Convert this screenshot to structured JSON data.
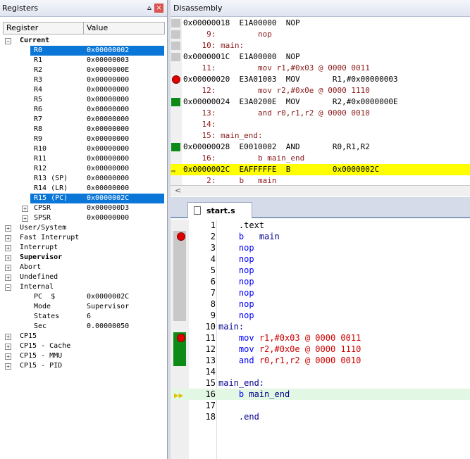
{
  "registers_panel": {
    "title": "Registers",
    "pin_icon": "⩟",
    "close_icon": "×",
    "col_register": "Register",
    "col_value": "Value",
    "rows": [
      {
        "name": "Current",
        "value": "",
        "indent": 0,
        "expand": "-",
        "bold": true
      },
      {
        "name": "R0",
        "value": "0x00000002",
        "indent": 2,
        "selected": true
      },
      {
        "name": "R1",
        "value": "0x00000003",
        "indent": 2
      },
      {
        "name": "R2",
        "value": "0x0000000E",
        "indent": 2
      },
      {
        "name": "R3",
        "value": "0x00000000",
        "indent": 2
      },
      {
        "name": "R4",
        "value": "0x00000000",
        "indent": 2
      },
      {
        "name": "R5",
        "value": "0x00000000",
        "indent": 2
      },
      {
        "name": "R6",
        "value": "0x00000000",
        "indent": 2
      },
      {
        "name": "R7",
        "value": "0x00000000",
        "indent": 2
      },
      {
        "name": "R8",
        "value": "0x00000000",
        "indent": 2
      },
      {
        "name": "R9",
        "value": "0x00000000",
        "indent": 2
      },
      {
        "name": "R10",
        "value": "0x00000000",
        "indent": 2
      },
      {
        "name": "R11",
        "value": "0x00000000",
        "indent": 2
      },
      {
        "name": "R12",
        "value": "0x00000000",
        "indent": 2
      },
      {
        "name": "R13 (SP)",
        "value": "0x00000000",
        "indent": 2
      },
      {
        "name": "R14 (LR)",
        "value": "0x00000000",
        "indent": 2
      },
      {
        "name": "R15 (PC)",
        "value": "0x0000002C",
        "indent": 2,
        "selected": true
      },
      {
        "name": "CPSR",
        "value": "0x000000D3",
        "indent": 2,
        "expand": "+"
      },
      {
        "name": "SPSR",
        "value": "0x00000000",
        "indent": 2,
        "expand": "+"
      },
      {
        "name": "User/System",
        "value": "",
        "indent": 0,
        "expand": "+"
      },
      {
        "name": "Fast Interrupt",
        "value": "",
        "indent": 0,
        "expand": "+"
      },
      {
        "name": "Interrupt",
        "value": "",
        "indent": 0,
        "expand": "+"
      },
      {
        "name": "Supervisor",
        "value": "",
        "indent": 0,
        "expand": "+",
        "bold": true
      },
      {
        "name": "Abort",
        "value": "",
        "indent": 0,
        "expand": "+"
      },
      {
        "name": "Undefined",
        "value": "",
        "indent": 0,
        "expand": "+"
      },
      {
        "name": "Internal",
        "value": "",
        "indent": 0,
        "expand": "-"
      },
      {
        "name": "PC  $",
        "value": "0x0000002C",
        "indent": 2
      },
      {
        "name": "Mode",
        "value": "Supervisor",
        "indent": 2
      },
      {
        "name": "States",
        "value": "6",
        "indent": 2
      },
      {
        "name": "Sec",
        "value": "0.00000050",
        "indent": 2
      },
      {
        "name": "CP15",
        "value": "",
        "indent": 0,
        "expand": "+"
      },
      {
        "name": "CP15 - Cache",
        "value": "",
        "indent": 0,
        "expand": "+"
      },
      {
        "name": "CP15 - MMU",
        "value": "",
        "indent": 0,
        "expand": "+"
      },
      {
        "name": "CP15 - PID",
        "value": "",
        "indent": 0,
        "expand": "+"
      }
    ]
  },
  "disassembly": {
    "title": "Disassembly",
    "scroll_left": "<",
    "rows": [
      {
        "text": "0x00000018  E1A00000  NOP",
        "kind": "asm",
        "mark": "gray"
      },
      {
        "text": "     9:         nop",
        "kind": "src",
        "mark": "gray"
      },
      {
        "text": "    10: main:",
        "kind": "src",
        "mark": "gray"
      },
      {
        "text": "0x0000001C  E1A00000  NOP",
        "kind": "asm",
        "mark": "gray"
      },
      {
        "text": "    11:         mov r1,#0x03 @ 0000 0011",
        "kind": "src",
        "mark": "none"
      },
      {
        "text": "0x00000020  E3A01003  MOV       R1,#0x00000003",
        "kind": "asm",
        "mark": "bp"
      },
      {
        "text": "    12:         mov r2,#0x0e @ 0000 1110",
        "kind": "src",
        "mark": "none"
      },
      {
        "text": "0x00000024  E3A0200E  MOV       R2,#0x0000000E",
        "kind": "asm",
        "mark": "green"
      },
      {
        "text": "    13:         and r0,r1,r2 @ 0000 0010",
        "kind": "src",
        "mark": "none"
      },
      {
        "text": "    14:",
        "kind": "src",
        "mark": "none"
      },
      {
        "text": "    15: main_end:",
        "kind": "src",
        "mark": "none"
      },
      {
        "text": "0x00000028  E0010002  AND       R0,R1,R2",
        "kind": "asm",
        "mark": "green"
      },
      {
        "text": "    16:         b main_end",
        "kind": "src",
        "mark": "none"
      },
      {
        "text": "0x0000002C  EAFFFFFE  B         0x0000002C",
        "kind": "asm",
        "mark": "arrow",
        "current": true
      },
      {
        "text": "     2:     b   main",
        "kind": "src",
        "mark": "none"
      }
    ]
  },
  "editor": {
    "tab_label": "start.s",
    "lines": [
      {
        "n": "1",
        "code": [
          [
            "    .text",
            ""
          ]
        ],
        "mark": "none"
      },
      {
        "n": "2",
        "code": [
          [
            "    ",
            ""
          ],
          [
            "b",
            "kw"
          ],
          [
            "   main",
            "lbl"
          ]
        ],
        "mark": "bp-gray"
      },
      {
        "n": "3",
        "code": [
          [
            "    ",
            ""
          ],
          [
            "nop",
            "kw"
          ]
        ],
        "mark": "gray"
      },
      {
        "n": "4",
        "code": [
          [
            "    ",
            ""
          ],
          [
            "nop",
            "kw"
          ]
        ],
        "mark": "gray"
      },
      {
        "n": "5",
        "code": [
          [
            "    ",
            ""
          ],
          [
            "nop",
            "kw"
          ]
        ],
        "mark": "gray"
      },
      {
        "n": "6",
        "code": [
          [
            "    ",
            ""
          ],
          [
            "nop",
            "kw"
          ]
        ],
        "mark": "gray"
      },
      {
        "n": "7",
        "code": [
          [
            "    ",
            ""
          ],
          [
            "nop",
            "kw"
          ]
        ],
        "mark": "gray"
      },
      {
        "n": "8",
        "code": [
          [
            "    ",
            ""
          ],
          [
            "nop",
            "kw"
          ]
        ],
        "mark": "gray"
      },
      {
        "n": "9",
        "code": [
          [
            "    ",
            ""
          ],
          [
            "nop",
            "kw"
          ]
        ],
        "mark": "gray"
      },
      {
        "n": "10",
        "code": [
          [
            "main:",
            "lbl"
          ]
        ],
        "mark": "none"
      },
      {
        "n": "11",
        "code": [
          [
            "    ",
            ""
          ],
          [
            "mov",
            "kw"
          ],
          [
            " r1,",
            "num"
          ],
          [
            "#0x03",
            "num"
          ],
          [
            " @ 0000 0011",
            "num"
          ]
        ],
        "mark": "bp-green"
      },
      {
        "n": "12",
        "code": [
          [
            "    ",
            ""
          ],
          [
            "mov",
            "kw"
          ],
          [
            " r2,",
            "num"
          ],
          [
            "#0x0e",
            "num"
          ],
          [
            " @ 0000 1110",
            "num"
          ]
        ],
        "mark": "green"
      },
      {
        "n": "13",
        "code": [
          [
            "    ",
            ""
          ],
          [
            "and",
            "kw"
          ],
          [
            " r0,r1,r2",
            "num"
          ],
          [
            " @ 0000 0010",
            "num"
          ]
        ],
        "mark": "green"
      },
      {
        "n": "14",
        "code": [],
        "mark": "none"
      },
      {
        "n": "15",
        "code": [
          [
            "main_end:",
            "lbl"
          ]
        ],
        "mark": "none"
      },
      {
        "n": "16",
        "code": [
          [
            "    ",
            ""
          ],
          [
            "b",
            "kw"
          ],
          [
            " main_end",
            "lbl"
          ]
        ],
        "mark": "arrow",
        "current": true
      },
      {
        "n": "17",
        "code": [],
        "mark": "none"
      },
      {
        "n": "18",
        "code": [
          [
            "    .end",
            "lbl"
          ]
        ],
        "mark": "none"
      }
    ]
  }
}
